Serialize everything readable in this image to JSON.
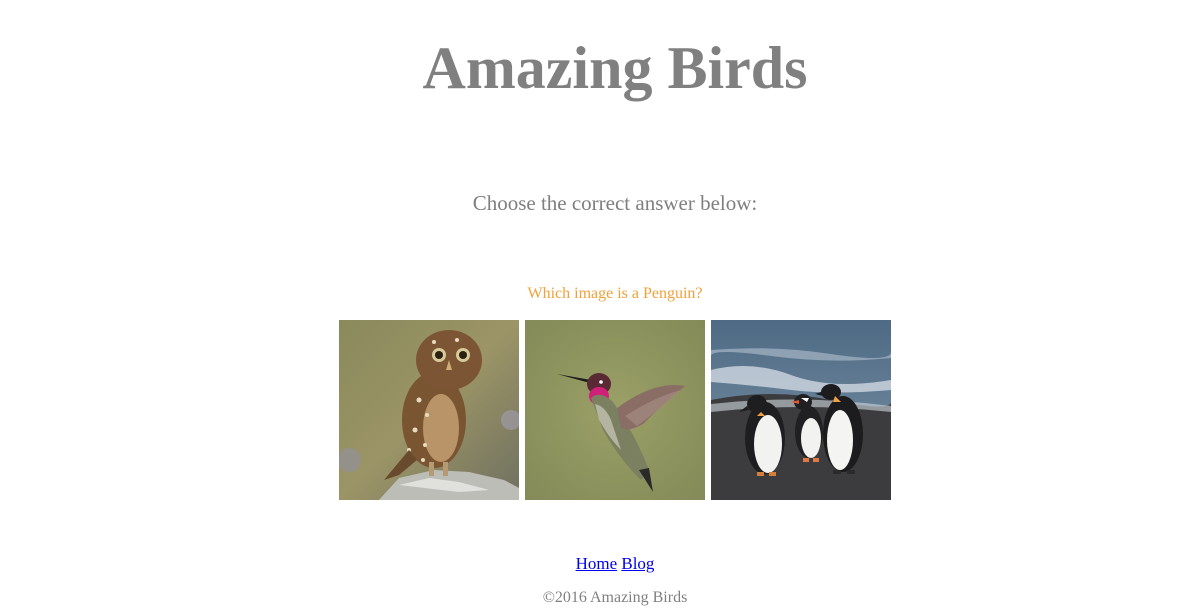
{
  "header": {
    "title": "Amazing Birds"
  },
  "quiz": {
    "instructions": "Choose the correct answer below:",
    "question": "Which image is a Penguin?",
    "question_color": "#f0a13a",
    "choices": [
      {
        "label": "owl",
        "icon": "owl-photo"
      },
      {
        "label": "hummingbird",
        "icon": "hummingbird-photo"
      },
      {
        "label": "penguins",
        "icon": "penguins-photo"
      }
    ]
  },
  "nav": {
    "home_label": "Home",
    "blog_label": "Blog",
    "link_color": "#0000ee"
  },
  "footer": {
    "copyright": "©2016 Amazing Birds"
  }
}
